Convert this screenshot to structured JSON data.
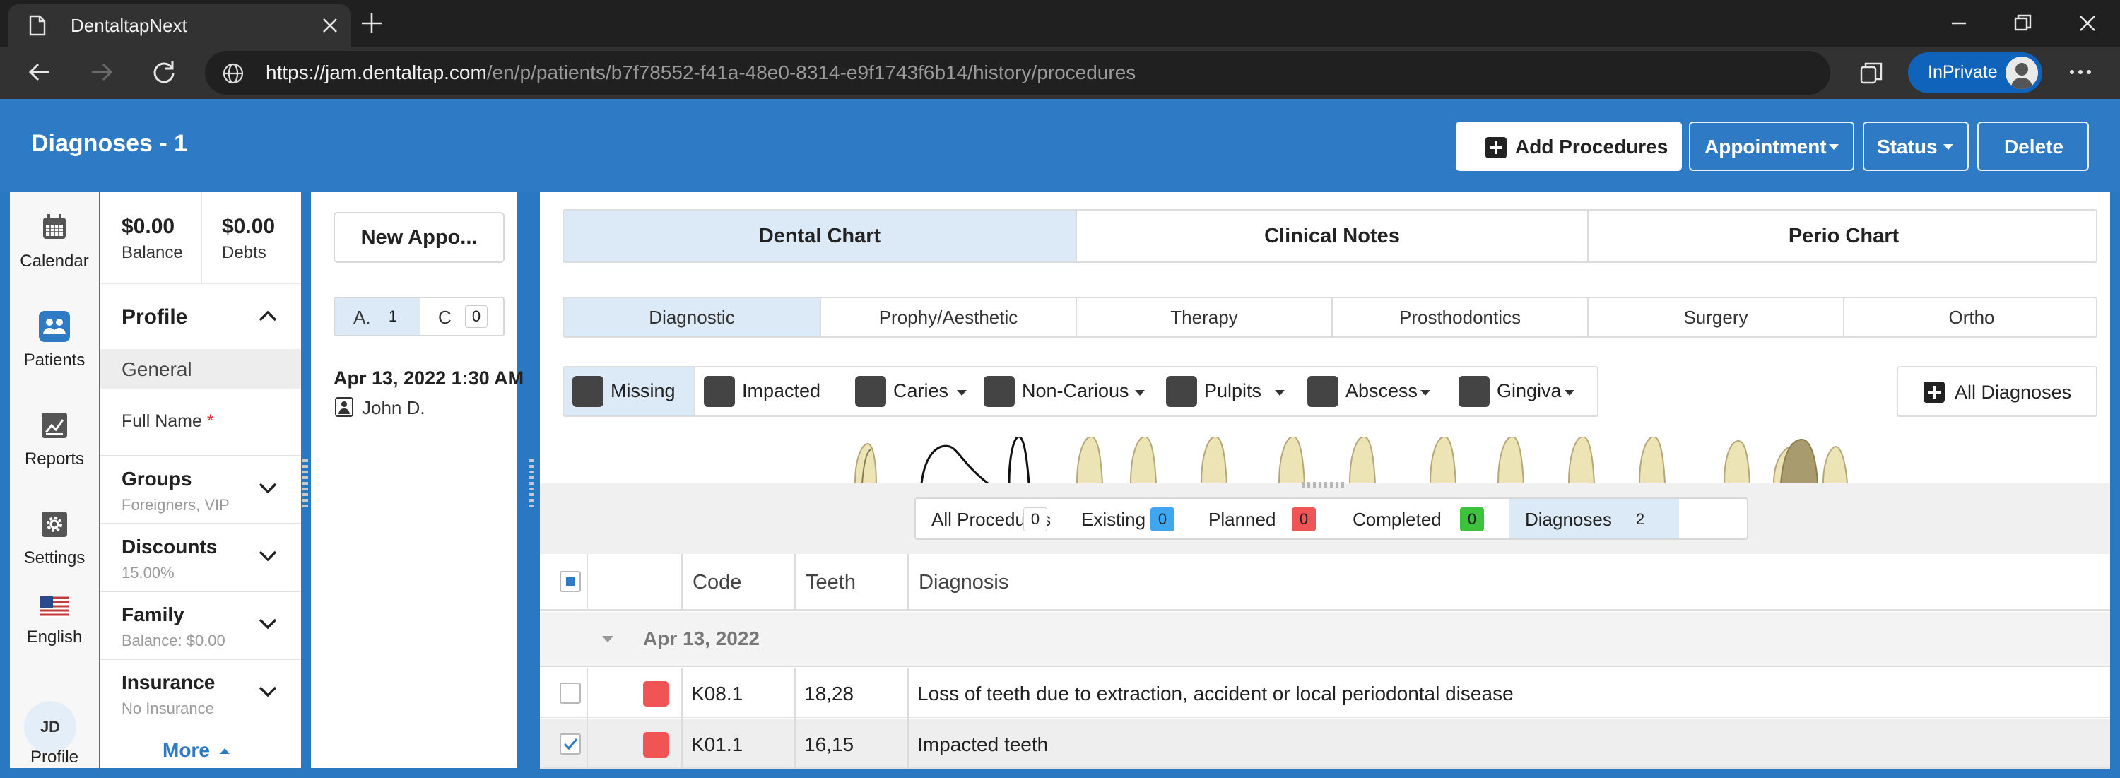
{
  "browser": {
    "tab_title": "DentaltapNext",
    "url_host": "https://jam.dentaltap.com",
    "url_path": "/en/p/patients/b7f78552-f41a-48e0-8314-e9f1743f6b14/history/procedures",
    "inprivate_label": "InPrivate"
  },
  "header": {
    "title": "Diagnoses - 1",
    "add_procedures": "Add Procedures",
    "appointment": "Appointment",
    "status": "Status",
    "delete": "Delete"
  },
  "nav": {
    "items": [
      {
        "label": "Calendar",
        "icon": "calendar-icon"
      },
      {
        "label": "Patients",
        "icon": "patients-icon"
      },
      {
        "label": "Reports",
        "icon": "reports-icon"
      },
      {
        "label": "Settings",
        "icon": "gear-icon"
      },
      {
        "label": "English",
        "icon": "us-flag-icon"
      }
    ],
    "profile_initials": "JD",
    "profile_label": "Profile"
  },
  "profile": {
    "balance_amount": "$0.00",
    "balance_label": "Balance",
    "debts_amount": "$0.00",
    "debts_label": "Debts",
    "section_title": "Profile",
    "general": "General",
    "full_name_label": "Full Name",
    "required_mark": "*",
    "groups": {
      "title": "Groups",
      "sub": "Foreigners, VIP"
    },
    "discounts": {
      "title": "Discounts",
      "sub": "15.00%"
    },
    "family": {
      "title": "Family",
      "sub": "Balance: $0.00"
    },
    "insurance": {
      "title": "Insurance",
      "sub": "No Insurance"
    },
    "more": "More"
  },
  "appointments": {
    "new_button": "New Appo...",
    "legend": {
      "a_label": "A.",
      "a_count": "1",
      "c_label": "C",
      "c_count": "0"
    },
    "entry_date": "Apr 13, 2022 1:30 AM",
    "entry_patient": "John D."
  },
  "main": {
    "tabs": [
      "Dental Chart",
      "Clinical Notes",
      "Perio Chart"
    ],
    "active_tab": 0,
    "subtabs": [
      "Diagnostic",
      "Prophy/Aesthetic",
      "Therapy",
      "Prosthodontics",
      "Surgery",
      "Ortho"
    ],
    "active_subtab": 0,
    "diagnosis_tools": [
      {
        "label": "Missing",
        "dropdown": false,
        "icon": "missing-tooth-icon"
      },
      {
        "label": "Impacted",
        "dropdown": false,
        "icon": "impacted-tooth-icon"
      },
      {
        "label": "Caries",
        "dropdown": true,
        "icon": "caries-tooth-icon"
      },
      {
        "label": "Non-Carious",
        "dropdown": true,
        "icon": "non-carious-tooth-icon"
      },
      {
        "label": "Pulpits",
        "dropdown": true,
        "icon": "pulpitis-tooth-icon"
      },
      {
        "label": "Abscess",
        "dropdown": true,
        "icon": "abscess-tooth-icon"
      },
      {
        "label": "Gingiva",
        "dropdown": true,
        "icon": "gingiva-icon"
      }
    ],
    "all_diagnoses": "All Diagnoses"
  },
  "filters": [
    {
      "label": "All Procedures",
      "count": "0",
      "color": "#ffffff"
    },
    {
      "label": "Existing",
      "count": "0",
      "color": "#3fa7f0"
    },
    {
      "label": "Planned",
      "count": "0",
      "color": "#f05454"
    },
    {
      "label": "Completed",
      "count": "0",
      "color": "#3cc23c"
    },
    {
      "label": "Diagnoses",
      "count": "2",
      "color": "#dceaf7"
    }
  ],
  "table": {
    "columns": [
      "Code",
      "Teeth",
      "Diagnosis"
    ],
    "group_date": "Apr 13, 2022",
    "rows": [
      {
        "code": "K08.1",
        "teeth": "18,28",
        "diagnosis": "Loss of teeth due to extraction, accident or local periodontal disease",
        "checked": false,
        "color": "#f05454"
      },
      {
        "code": "K01.1",
        "teeth": "16,15",
        "diagnosis": "Impacted teeth",
        "checked": true,
        "color": "#f05454"
      }
    ]
  },
  "colors": {
    "brand_blue": "#2e7ac4",
    "active_tab_bg": "#dceaf7",
    "diagnosis_red": "#f05454"
  }
}
